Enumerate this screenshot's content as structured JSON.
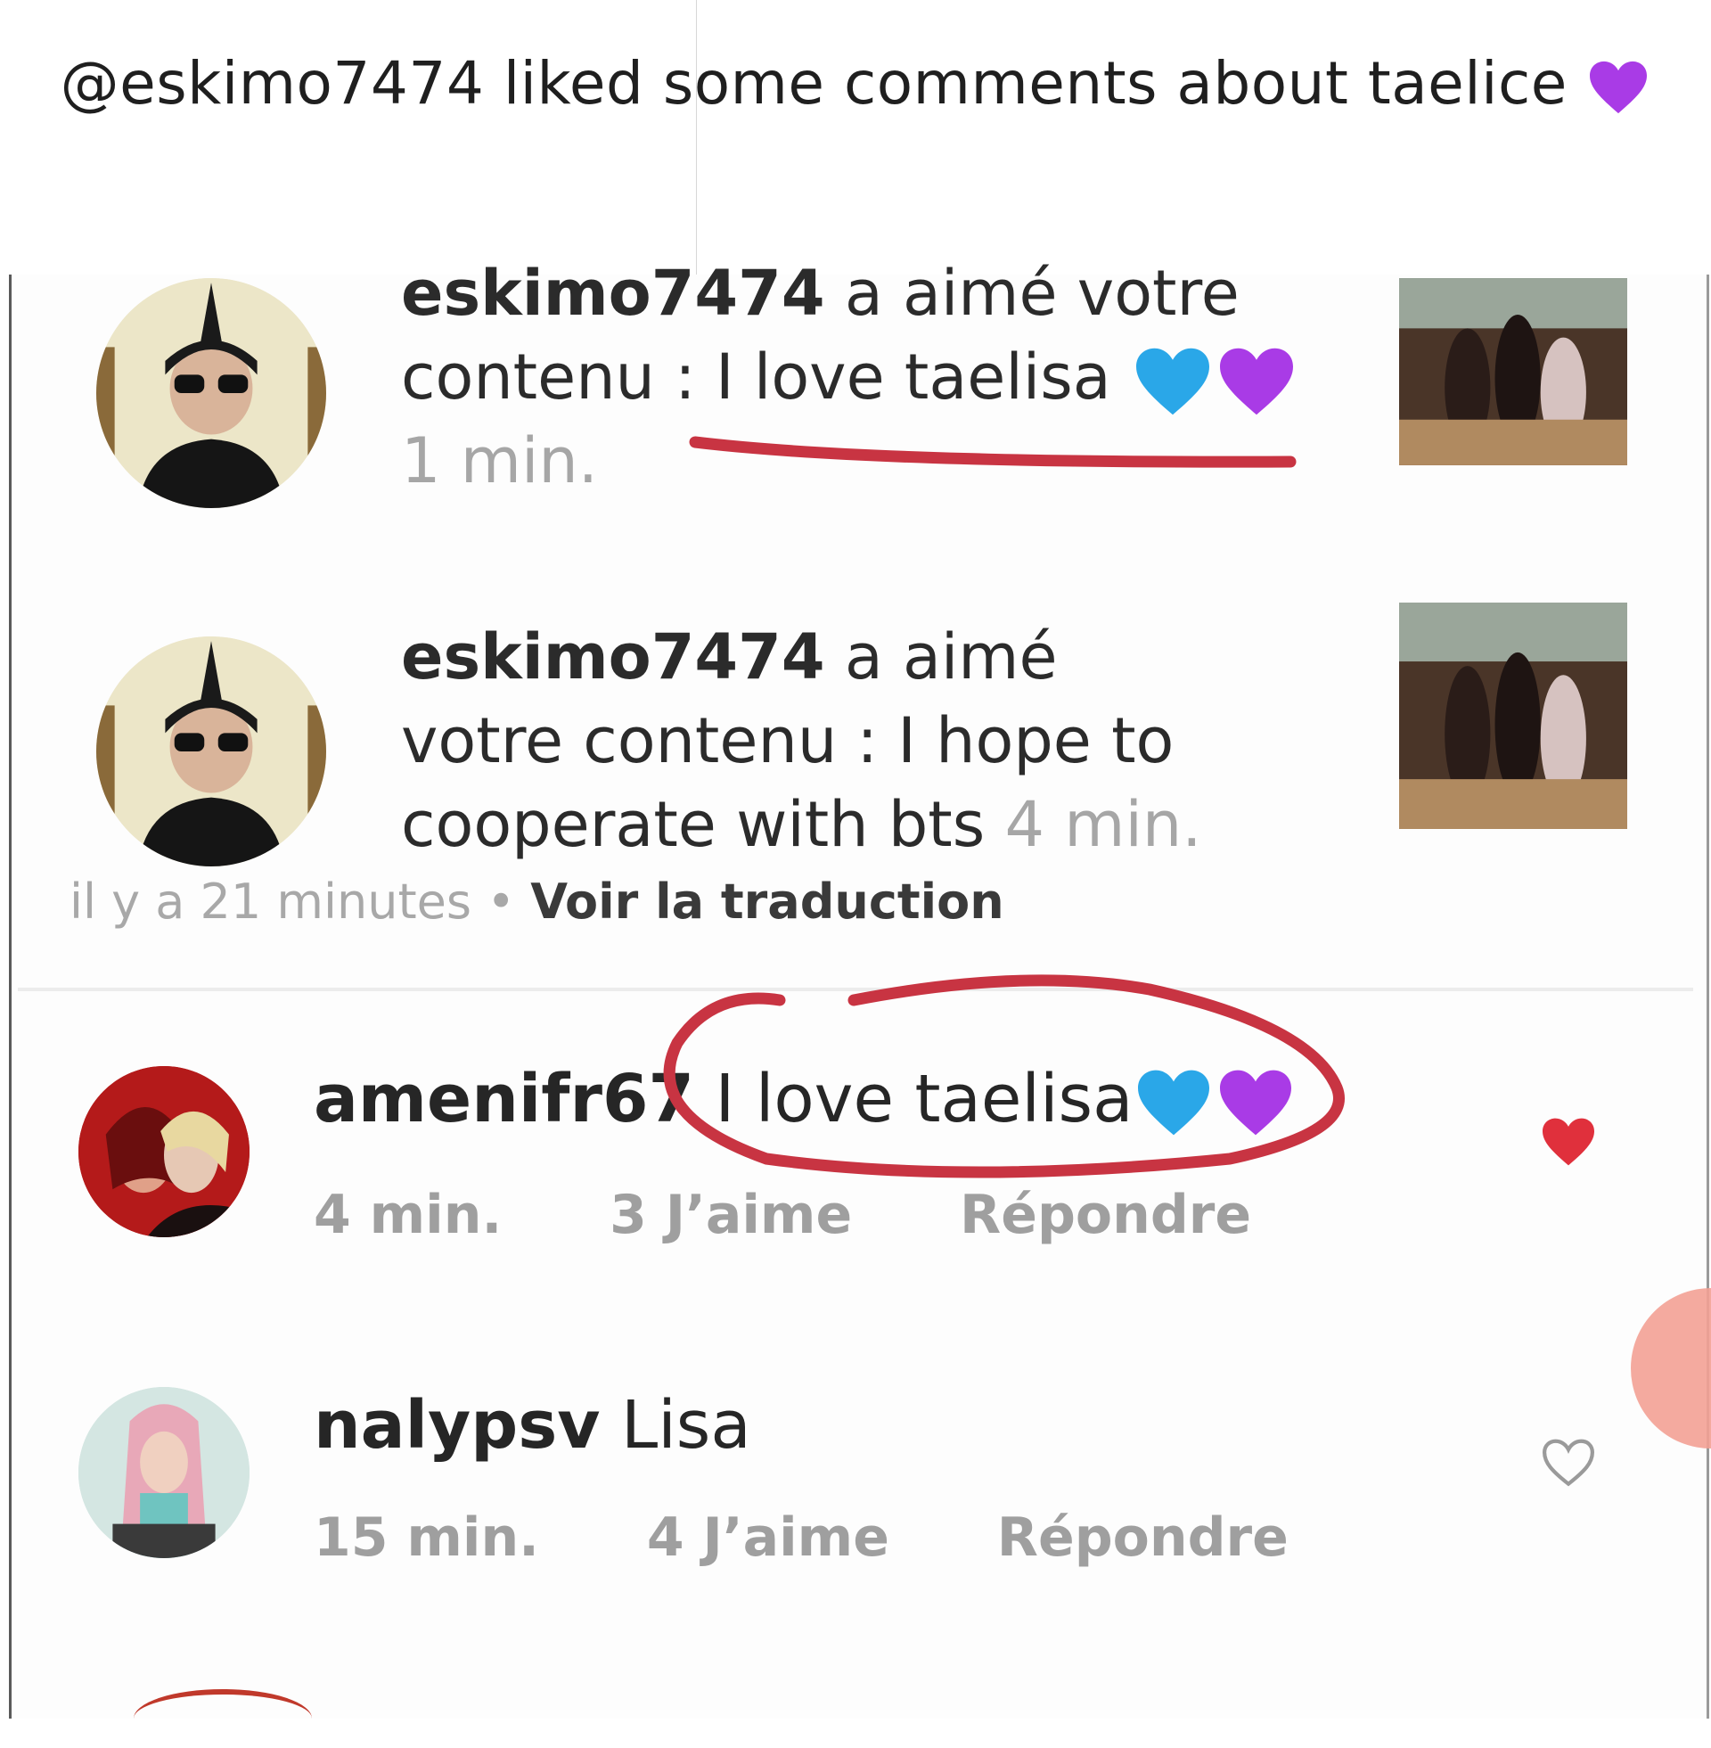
{
  "caption": {
    "text": "@eskimo7474 liked some comments about taelice"
  },
  "notifications": [
    {
      "user": "eskimo7474",
      "line1_rest": "a aimé votre",
      "line2": "contenu : I love taelisa",
      "time": "1 min."
    },
    {
      "user": "eskimo7474",
      "line1_rest": "a aimé",
      "line2": "votre contenu : I hope to",
      "line3": "cooperate with bts",
      "time": "4 min."
    }
  ],
  "post_meta": {
    "ago": "il y a 21 minutes",
    "separator": "•",
    "translate_link": "Voir la traduction"
  },
  "comments": [
    {
      "user": "amenifr67",
      "text": "I love taelisa",
      "time": "4 min.",
      "likes": "3 J’aime",
      "reply": "Répondre",
      "liked": true
    },
    {
      "user": "nalypsv",
      "text": "Lisa",
      "time": "15 min.",
      "likes": "4 J’aime",
      "reply": "Répondre",
      "liked": false
    }
  ],
  "colors": {
    "heart_blue": "#2aa7e8",
    "heart_purple": "#a93be6",
    "like_red": "#e0303c",
    "annotation_red": "#c83442"
  }
}
